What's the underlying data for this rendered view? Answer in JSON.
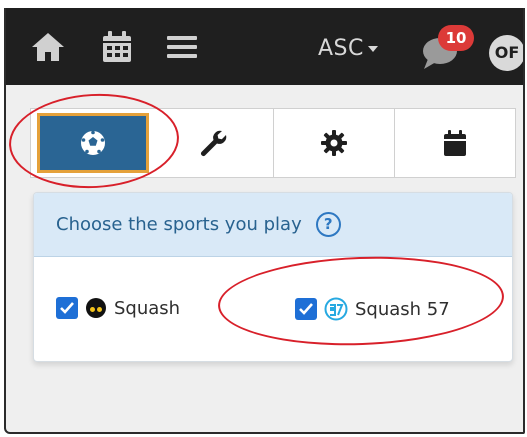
{
  "topbar": {
    "home_icon": "home-icon",
    "calendar_icon": "calendar-icon",
    "menu_icon": "hamburger-menu-icon",
    "club_selector": "ASC",
    "messages_badge": "10",
    "avatar_initials": "OF"
  },
  "tabs": [
    {
      "name": "sports",
      "icon": "soccer-ball-icon",
      "active": true
    },
    {
      "name": "tools",
      "icon": "wrench-icon",
      "active": false
    },
    {
      "name": "settings",
      "icon": "gear-icon",
      "active": false
    },
    {
      "name": "calendar",
      "icon": "calendar-icon",
      "active": false
    }
  ],
  "panel": {
    "title": "Choose the sports you play",
    "help": "?",
    "sports": [
      {
        "label": "Squash",
        "checked": true,
        "icon": "squash-ball-icon"
      },
      {
        "label": "Squash 57",
        "checked": true,
        "icon": "squash57-logo-icon"
      }
    ]
  },
  "colors": {
    "topbar": "#1f1f1f",
    "active_tab": "#2a6594",
    "active_tab_border": "#e5a13a",
    "badge": "#dc3a38",
    "checkbox": "#1e6fd6",
    "panel_header": "#d9e9f7",
    "annotation": "#d8202a"
  }
}
